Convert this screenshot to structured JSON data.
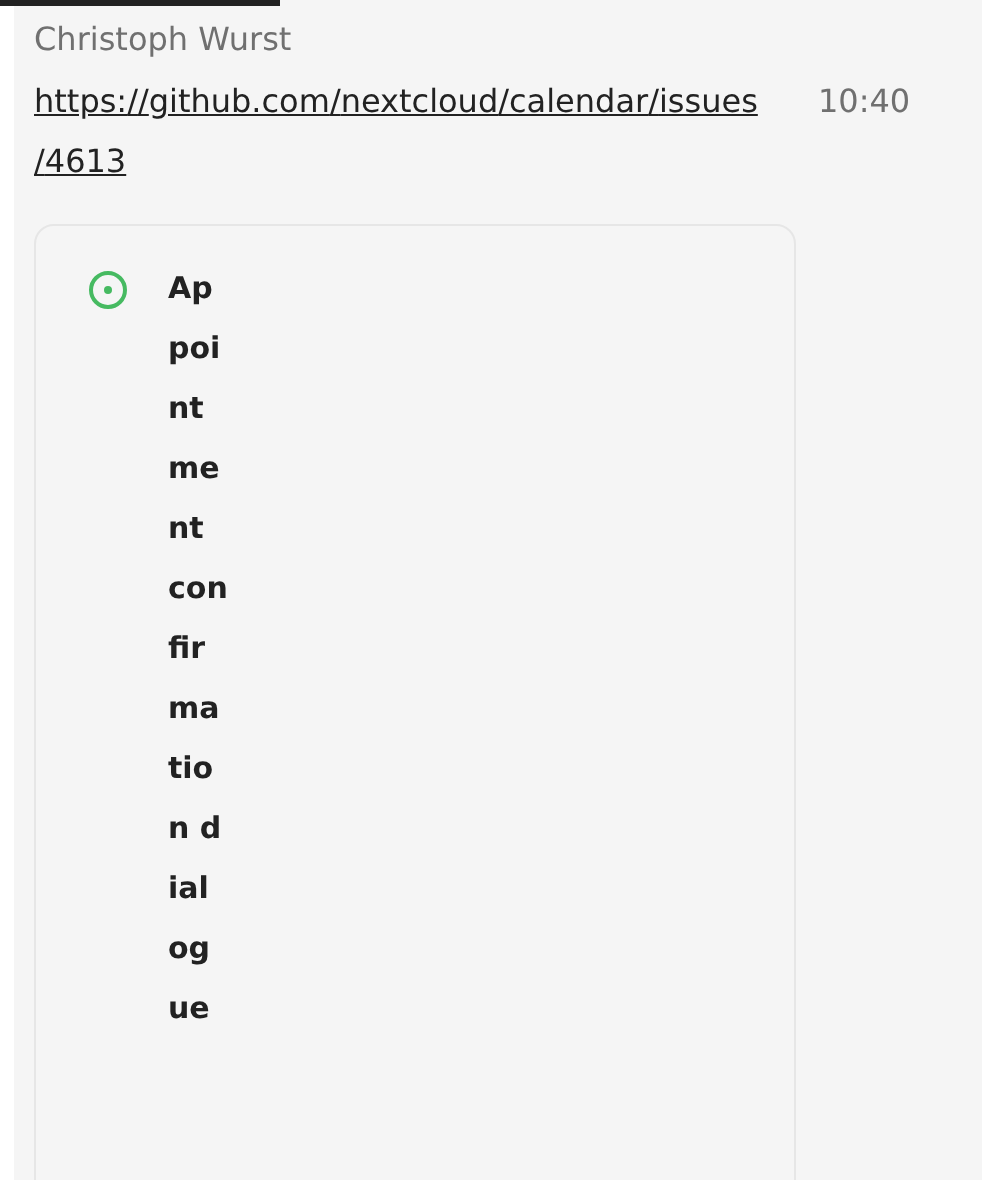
{
  "message": {
    "author": "Christoph Wurst",
    "link": "https://github.com/nextcloud/calendar/issues/4613",
    "time": "10:40",
    "preview": {
      "open": true,
      "title": "Appointment confirmation dialogue"
    }
  }
}
